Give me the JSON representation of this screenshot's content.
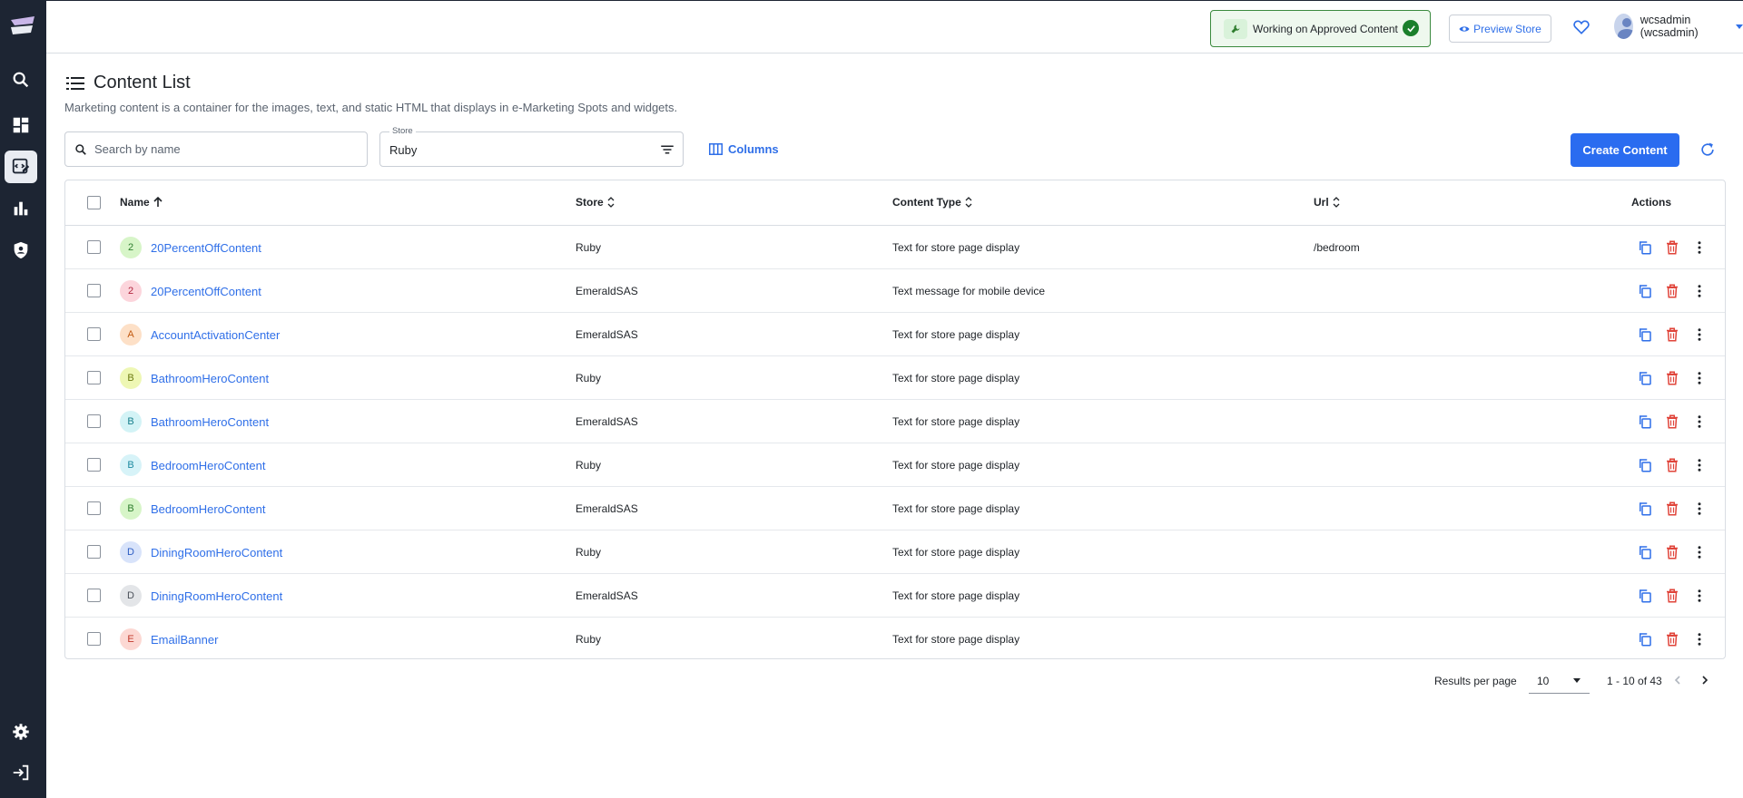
{
  "topbar": {
    "status_label": "Working on Approved Content",
    "preview_label": "Preview Store",
    "user_label": "wcsadmin (wcsadmin)"
  },
  "header": {
    "title": "Content List",
    "subtitle": "Marketing content is a container for the images, text, and static HTML that displays in e-Marketing Spots and widgets."
  },
  "toolbar": {
    "search_placeholder": "Search by name",
    "store_label": "Store",
    "store_value": "Ruby",
    "columns_label": "Columns",
    "create_label": "Create Content"
  },
  "table": {
    "headers": {
      "name": "Name",
      "store": "Store",
      "type": "Content Type",
      "url": "Url",
      "actions": "Actions"
    },
    "rows": [
      {
        "letter": "2",
        "name": "20PercentOffContent",
        "store": "Ruby",
        "type": "Text for store page display",
        "url": "/bedroom",
        "badge_bg": "#d7f5c8",
        "badge_fg": "#2e7d2e"
      },
      {
        "letter": "2",
        "name": "20PercentOffContent",
        "store": "EmeraldSAS",
        "type": "Text message for mobile device",
        "url": "",
        "badge_bg": "#fcd5dc",
        "badge_fg": "#b0263e"
      },
      {
        "letter": "A",
        "name": "AccountActivationCenter",
        "store": "EmeraldSAS",
        "type": "Text for store page display",
        "url": "",
        "badge_bg": "#fde0c7",
        "badge_fg": "#c25a12"
      },
      {
        "letter": "B",
        "name": "BathroomHeroContent",
        "store": "Ruby",
        "type": "Text for store page display",
        "url": "",
        "badge_bg": "#eef7b4",
        "badge_fg": "#6b7a10"
      },
      {
        "letter": "B",
        "name": "BathroomHeroContent",
        "store": "EmeraldSAS",
        "type": "Text for store page display",
        "url": "",
        "badge_bg": "#d3f3f6",
        "badge_fg": "#177f8c"
      },
      {
        "letter": "B",
        "name": "BedroomHeroContent",
        "store": "Ruby",
        "type": "Text for store page display",
        "url": "",
        "badge_bg": "#d7f3f8",
        "badge_fg": "#1d8aa0"
      },
      {
        "letter": "B",
        "name": "BedroomHeroContent",
        "store": "EmeraldSAS",
        "type": "Text for store page display",
        "url": "",
        "badge_bg": "#d7f5c8",
        "badge_fg": "#2e7d2e"
      },
      {
        "letter": "D",
        "name": "DiningRoomHeroContent",
        "store": "Ruby",
        "type": "Text for store page display",
        "url": "",
        "badge_bg": "#d8e3fa",
        "badge_fg": "#2f5fc4"
      },
      {
        "letter": "D",
        "name": "DiningRoomHeroContent",
        "store": "EmeraldSAS",
        "type": "Text for store page display",
        "url": "",
        "badge_bg": "#e3e5e8",
        "badge_fg": "#4a5059"
      },
      {
        "letter": "E",
        "name": "EmailBanner",
        "store": "Ruby",
        "type": "Text for store page display",
        "url": "",
        "badge_bg": "#fcd8d3",
        "badge_fg": "#c0392b"
      }
    ]
  },
  "pagination": {
    "rpp_label": "Results per page",
    "rpp_value": "10",
    "range": "1 - 10 of 43"
  },
  "colors": {
    "sidebar": "#1d2533",
    "accent": "#2a6cf0",
    "delete": "#e0443a"
  }
}
